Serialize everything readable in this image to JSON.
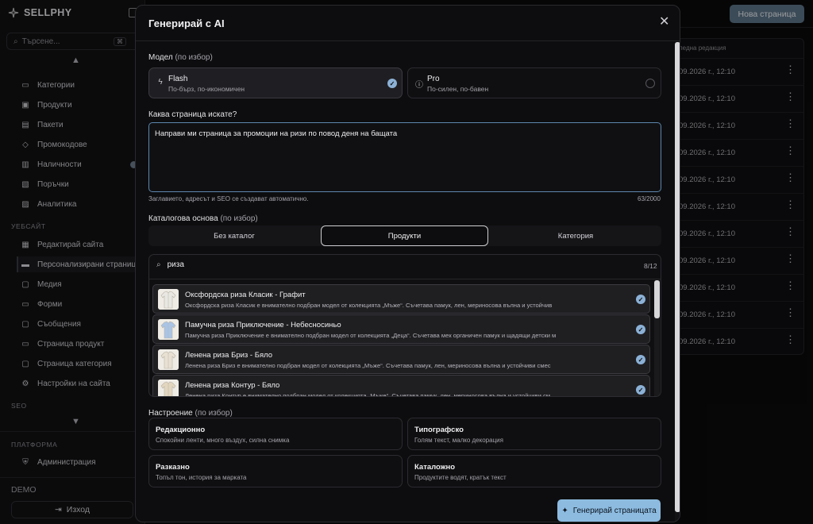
{
  "app": {
    "logo": "SELLPHY",
    "search_placeholder": "Търсене...",
    "search_kbd": "⌘",
    "nav_top": [
      "Категории",
      "Продукти",
      "Пакети",
      "Промокодове",
      "Наличности",
      "Поръчки",
      "Аналитика"
    ],
    "section_website": "УЕБСАЙТ",
    "nav_website": [
      "Редактирай сайта",
      "Персонализирани страници",
      "Медия",
      "Форми",
      "Съобщения",
      "Страница продукт",
      "Страница категория",
      "Настройки на сайта"
    ],
    "section_seo": "SEO",
    "section_platform": "ПЛАТФОРМА",
    "nav_platform": [
      "Администрация"
    ],
    "demo": "DEMO",
    "logout": "Изход",
    "new_page_button": "Нова страница",
    "table_header": "ледна редакция",
    "row_dates": [
      "09.2026 г., 12:10",
      "09.2026 г., 12:10",
      "09.2026 г., 12:10",
      "09.2026 г., 12:10",
      "09.2026 г., 12:10",
      "09.2026 г., 12:10",
      "09.2026 г., 12:10",
      "09.2026 г., 12:10",
      "09.2026 г., 12:10",
      "09.2026 г., 12:10",
      "09.2026 г., 12:10"
    ]
  },
  "modal": {
    "title": "Генерирай с AI",
    "model_label": "Модел",
    "optional": "(по избор)",
    "models": [
      {
        "name": "Flash",
        "desc": "По-бърз, по-икономичен",
        "selected": true
      },
      {
        "name": "Pro",
        "desc": "По-силен, по-бавен",
        "selected": false
      }
    ],
    "prompt_label": "Каква страница искате?",
    "prompt_value": "Направи ми страница за промоции на ризи по повод деня на бащата",
    "helper": "Заглавието, адресът и SEO се създават автоматично.",
    "counter": "63/2000",
    "catalog_label": "Каталогова основа",
    "tabs": [
      {
        "label": "Без каталог",
        "selected": false
      },
      {
        "label": "Продукти",
        "selected": true
      },
      {
        "label": "Категория",
        "selected": false
      }
    ],
    "product_search_value": "риза",
    "product_count": "8/12",
    "products": [
      {
        "name": "Оксфордска риза Класик - Графит",
        "desc": "Оксфордска риза Класик е внимателно подбран модел от колекцията „Мъже“. Съчетава памук, лен, мериносова вълна и устойчив",
        "shirt_color": "#e9e7e2"
      },
      {
        "name": "Памучна риза Приключение - Небесносиньо",
        "desc": "Памучна риза Приключение е внимателно подбран модел от колекцията „Деца“. Съчетава мек органичен памук и щадящи детски м",
        "shirt_color": "#a9c4e6"
      },
      {
        "name": "Ленена риза Бриз - Бяло",
        "desc": "Ленена риза Бриз е внимателно подбран модел от колекцията „Мъже“. Съчетава памук, лен, мериносова вълна и устойчиви смес",
        "shirt_color": "#e8e1d3"
      },
      {
        "name": "Ленена риза Контур - Бяло",
        "desc": "Ленена риза Контур е внимателно подбран модел от колекцията „Мъже“. Съчетава памук, лен, мериносова вълна и устойчиви см",
        "shirt_color": "#e2d6bf"
      }
    ],
    "mood_label": "Настроение",
    "moods": [
      {
        "name": "Редакционно",
        "desc": "Спокойни ленти, много въздух, силна снимка"
      },
      {
        "name": "Типографско",
        "desc": "Голям текст, малко декорация"
      },
      {
        "name": "Разказно",
        "desc": "Топъл тон, история за марката"
      },
      {
        "name": "Каталожно",
        "desc": "Продуктите водят, кратък текст"
      }
    ],
    "generate_button": "Генерирай страницата"
  }
}
